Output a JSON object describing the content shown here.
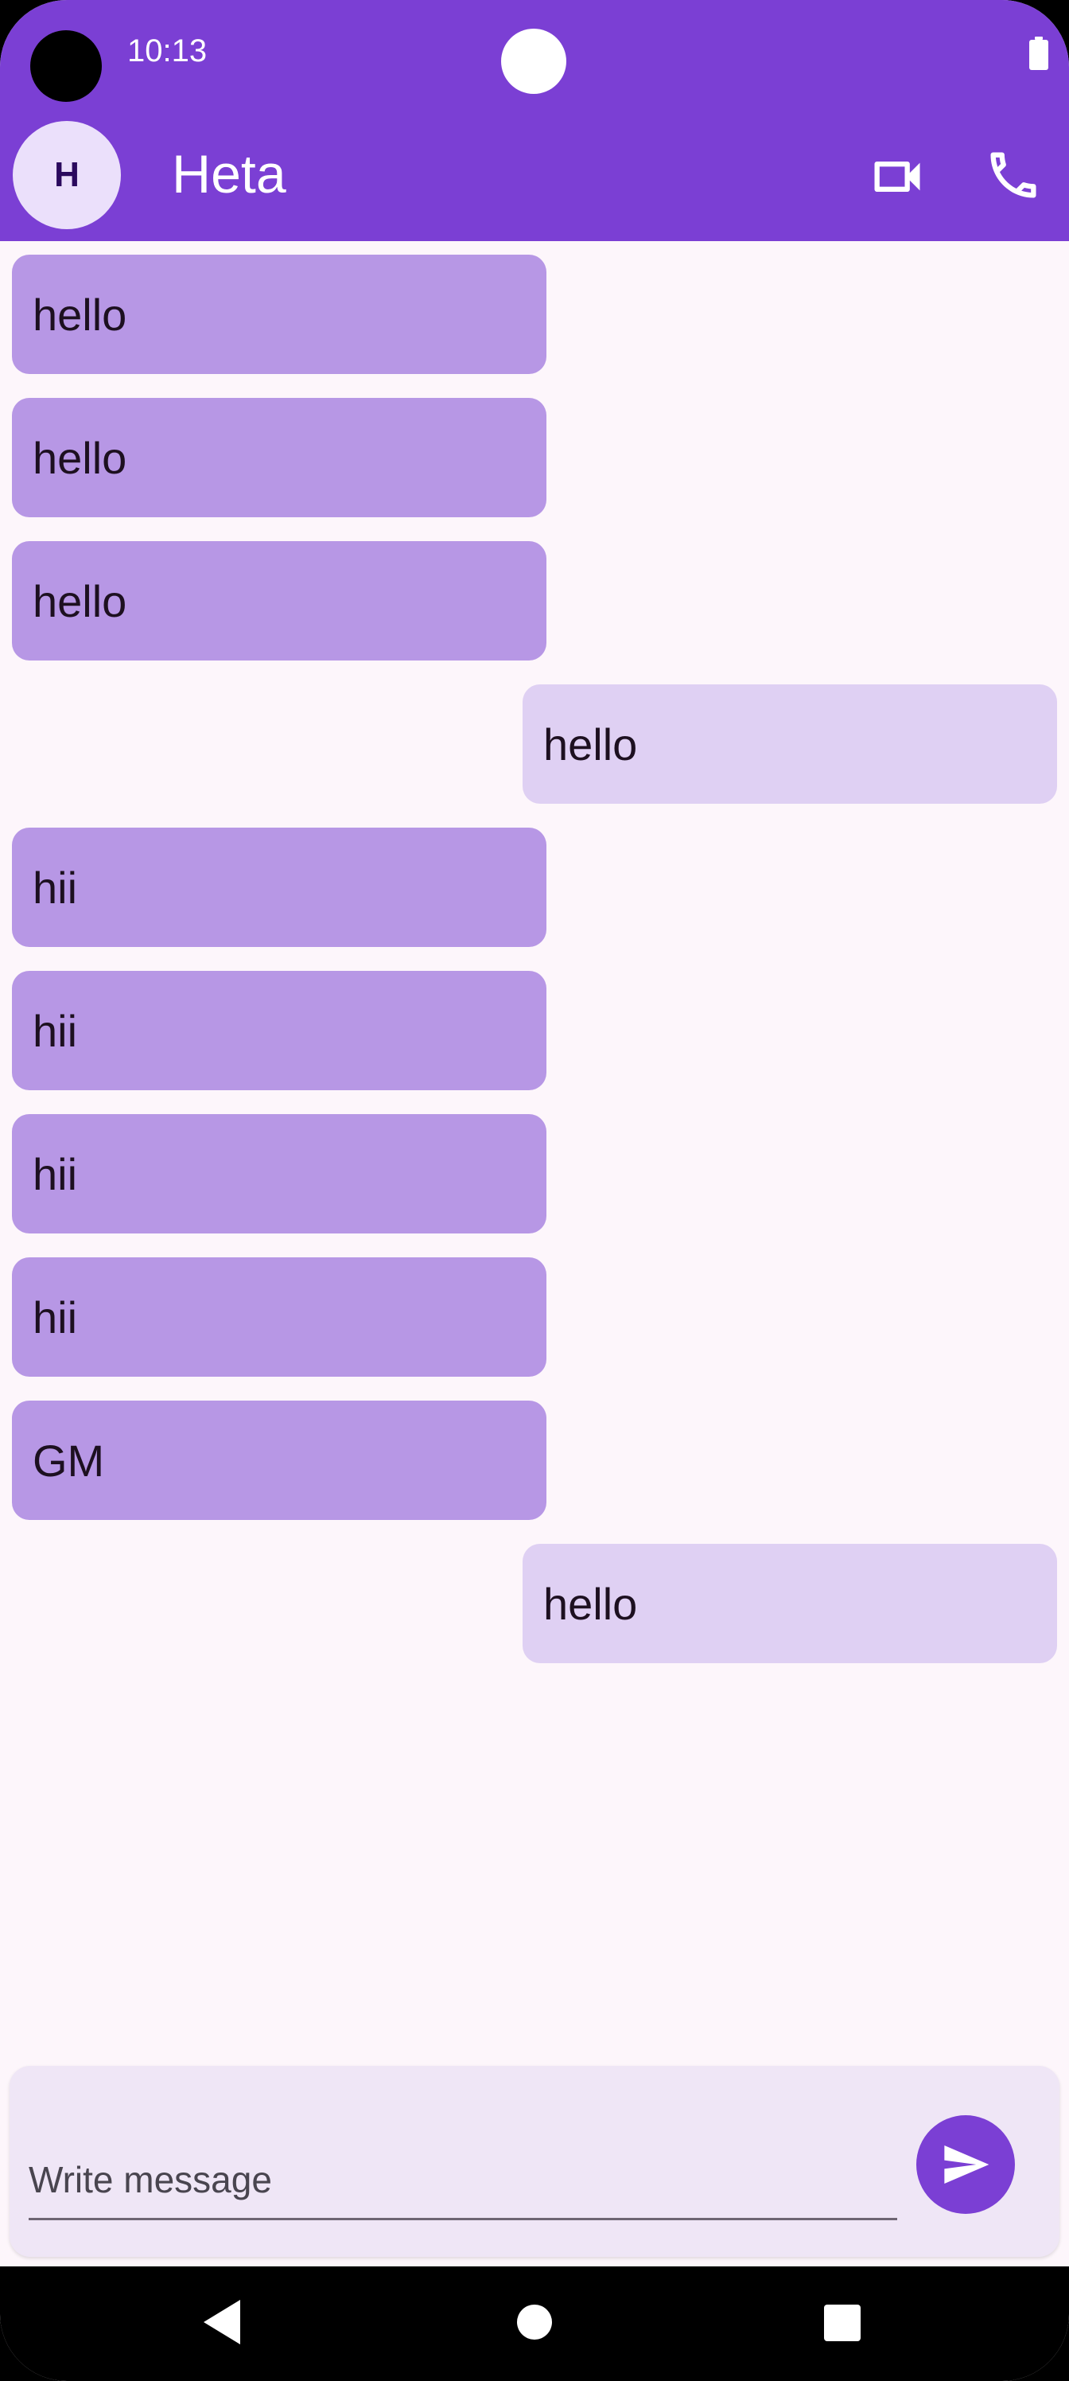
{
  "status_bar": {
    "time": "10:13"
  },
  "header": {
    "avatar_initial": "H",
    "contact_name": "Heta",
    "video_icon": "video-camera-icon",
    "call_icon": "phone-icon"
  },
  "messages": [
    {
      "text": "hello",
      "direction": "received"
    },
    {
      "text": "hello",
      "direction": "received"
    },
    {
      "text": "hello",
      "direction": "received"
    },
    {
      "text": "hello",
      "direction": "sent"
    },
    {
      "text": "hii",
      "direction": "received"
    },
    {
      "text": "hii",
      "direction": "received"
    },
    {
      "text": "hii",
      "direction": "received"
    },
    {
      "text": "hii",
      "direction": "received"
    },
    {
      "text": "GM",
      "direction": "received"
    },
    {
      "text": "hello",
      "direction": "sent"
    }
  ],
  "composer": {
    "value": "",
    "placeholder": "Write message",
    "send_icon": "send-icon"
  },
  "colors": {
    "primary": "#7b3fd4",
    "received_bubble": "#b797e5",
    "sent_bubble": "#dfd0f3",
    "background": "#fdf6fb"
  }
}
